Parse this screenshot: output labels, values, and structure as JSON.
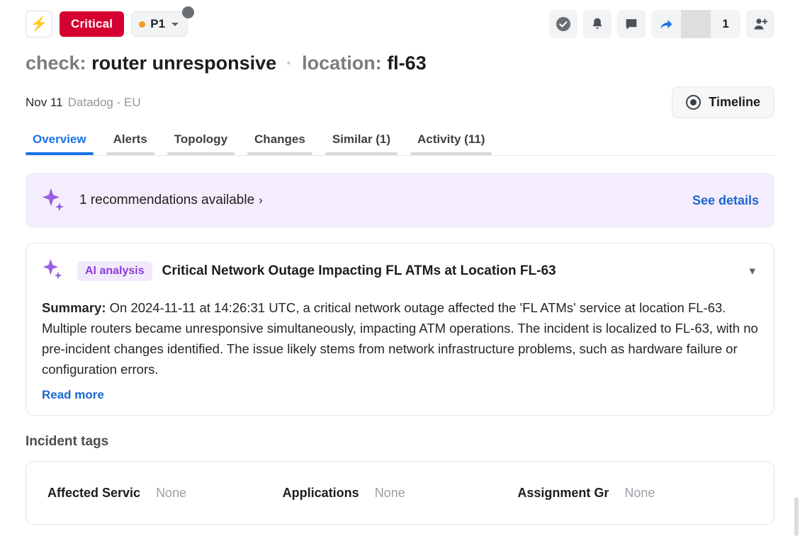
{
  "header": {
    "bolt_icon": "lightning-bolt-icon",
    "severity_label": "Critical",
    "priority_label": "P1",
    "actions": {
      "resolve_icon": "check-circle-icon",
      "notify_icon": "bell-icon",
      "comment_icon": "comment-icon",
      "share_icon": "share-arrow-icon",
      "share_count": "1",
      "add_user_icon": "add-user-icon"
    }
  },
  "title": {
    "check_label": "check:",
    "check_value": "router unresponsive",
    "separator": "·",
    "location_label": "location:",
    "location_value": "fl-63"
  },
  "meta": {
    "date": "Nov 11",
    "source": "Datadog - EU",
    "timeline_button": "Timeline"
  },
  "tabs": [
    {
      "label": "Overview",
      "active": true
    },
    {
      "label": "Alerts",
      "active": false
    },
    {
      "label": "Topology",
      "active": false
    },
    {
      "label": "Changes",
      "active": false
    },
    {
      "label": "Similar (1)",
      "active": false
    },
    {
      "label": "Activity (11)",
      "active": false
    }
  ],
  "recommendation": {
    "icon": "sparkle-icon",
    "text": "1 recommendations available",
    "chevron": "›",
    "link": "See details"
  },
  "ai_analysis": {
    "icon": "sparkle-icon",
    "pill": "AI analysis",
    "title": "Critical Network Outage Impacting FL ATMs at Location FL-63",
    "collapse_icon": "chevron-down-icon",
    "summary_label": "Summary:",
    "summary_text": " On 2024-11-11 at 14:26:31 UTC, a critical network outage affected the 'FL ATMs' service at location FL-63. Multiple routers became unresponsive simultaneously, impacting ATM operations. The incident is localized to FL-63, with no pre-incident changes identified. The issue likely stems from network infrastructure problems, such as hardware failure or configuration errors.",
    "read_more": "Read more"
  },
  "incident_tags": {
    "heading": "Incident tags",
    "rows": [
      {
        "key": "Affected Servic",
        "value": "None"
      },
      {
        "key": "Applications",
        "value": "None"
      },
      {
        "key": "Assignment Gr",
        "value": "None"
      }
    ]
  },
  "colors": {
    "critical_red": "#d50032",
    "priority_orange": "#f59a1d",
    "accent_blue": "#1a73e8",
    "link_blue": "#1967d2",
    "sparkle_purple": "#9b5de0",
    "ai_pill_purple": "#8b3ddb",
    "banner_purple_bg": "#f4edfd"
  }
}
